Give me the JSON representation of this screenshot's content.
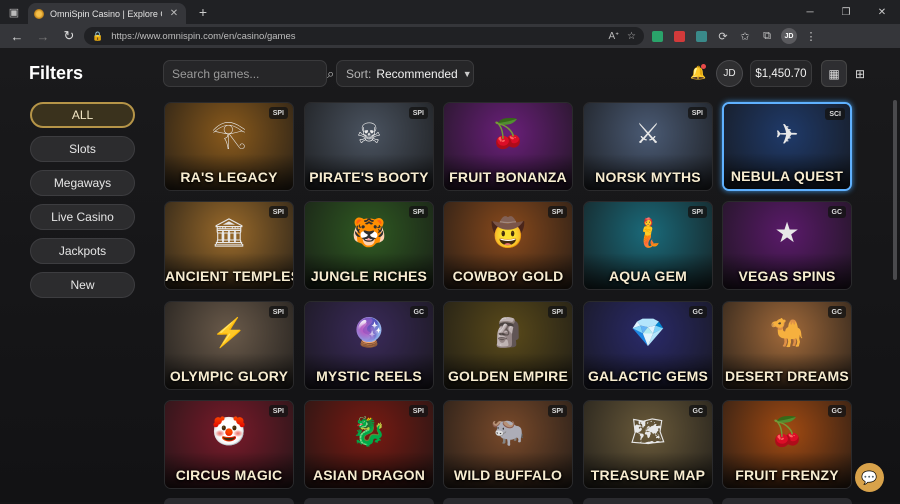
{
  "browser": {
    "tab_title": "OmniSpin Casino | Explore Games",
    "url": "https://www.omnispin.com/en/casino/games",
    "profile_initials": "JD"
  },
  "sidebar": {
    "title": "Filters",
    "filters": [
      {
        "label": "ALL",
        "active": true
      },
      {
        "label": "Slots",
        "active": false
      },
      {
        "label": "Megaways",
        "active": false
      },
      {
        "label": "Live Casino",
        "active": false
      },
      {
        "label": "Jackpots",
        "active": false
      },
      {
        "label": "New",
        "active": false
      }
    ]
  },
  "toolbar": {
    "search_placeholder": "Search games...",
    "sort_label": "Sort:",
    "sort_value": "Recommended",
    "user_initials": "JD",
    "balance": "$1,450.70"
  },
  "colors": {
    "accent_gold": "#b69548",
    "selected_blue": "#5fb1ff",
    "background": "#141416"
  },
  "games": [
    {
      "title": "RA'S LEGACY",
      "provider": "SPI",
      "icon": "pharaoh-icon",
      "glyph": "𓂀",
      "bg": "#8a5a1c"
    },
    {
      "title": "PIRATE'S BOOTY",
      "provider": "SPI",
      "icon": "skull-icon",
      "glyph": "☠",
      "bg": "#4a5360"
    },
    {
      "title": "FRUIT BONANZA",
      "provider": "",
      "icon": "fruit-icon",
      "glyph": "🍒",
      "bg": "#6a1f7a"
    },
    {
      "title": "NORSK MYTHS",
      "provider": "SPI",
      "icon": "viking-icon",
      "glyph": "⚔",
      "bg": "#4a5a74"
    },
    {
      "title": "NEBULA QUEST",
      "provider": "SCI",
      "icon": "spaceship-icon",
      "glyph": "✈",
      "bg": "#1f3a6a"
    },
    {
      "title": "ANCIENT TEMPLES",
      "provider": "SPI",
      "icon": "temple-icon",
      "glyph": "🏛",
      "bg": "#9a6a2a"
    },
    {
      "title": "JUNGLE RICHES",
      "provider": "SPI",
      "icon": "tiger-icon",
      "glyph": "🐯",
      "bg": "#2f5a22"
    },
    {
      "title": "COWBOY GOLD",
      "provider": "SPI",
      "icon": "cowboy-icon",
      "glyph": "🤠",
      "bg": "#8a4a1c"
    },
    {
      "title": "AQUA GEM",
      "provider": "SPI",
      "icon": "mermaid-icon",
      "glyph": "🧜",
      "bg": "#1a6a7a"
    },
    {
      "title": "VEGAS SPINS",
      "provider": "GC",
      "icon": "neon-sign-icon",
      "glyph": "★",
      "bg": "#5a1a6a"
    },
    {
      "title": "OLYMPIC GLORY",
      "provider": "SPI",
      "icon": "zeus-icon",
      "glyph": "⚡",
      "bg": "#6a5a4a"
    },
    {
      "title": "MYSTIC REELS",
      "provider": "GC",
      "icon": "witch-icon",
      "glyph": "🔮",
      "bg": "#3a2a5a"
    },
    {
      "title": "GOLDEN EMPIRE",
      "provider": "SPI",
      "icon": "mask-icon",
      "glyph": "🗿",
      "bg": "#5a4a1a"
    },
    {
      "title": "GALACTIC GEMS",
      "provider": "GC",
      "icon": "diamond-icon",
      "glyph": "💎",
      "bg": "#2a2a6a"
    },
    {
      "title": "DESERT DREAMS",
      "provider": "GC",
      "icon": "camel-icon",
      "glyph": "🐪",
      "bg": "#a26a3a"
    },
    {
      "title": "CIRCUS MAGIC",
      "provider": "SPI",
      "icon": "clown-icon",
      "glyph": "🤡",
      "bg": "#7a1a2a"
    },
    {
      "title": "ASIAN DRAGON",
      "provider": "SPI",
      "icon": "dragon-icon",
      "glyph": "🐉",
      "bg": "#7a1a12"
    },
    {
      "title": "WILD BUFFALO",
      "provider": "SPI",
      "icon": "buffalo-icon",
      "glyph": "🐃",
      "bg": "#7a4a2a"
    },
    {
      "title": "TREASURE MAP",
      "provider": "GC",
      "icon": "map-icon",
      "glyph": "🗺",
      "bg": "#6a5a3a"
    },
    {
      "title": "FRUIT FRENZY",
      "provider": "GC",
      "icon": "fruit-icon",
      "glyph": "🍒",
      "bg": "#a24a12"
    }
  ]
}
